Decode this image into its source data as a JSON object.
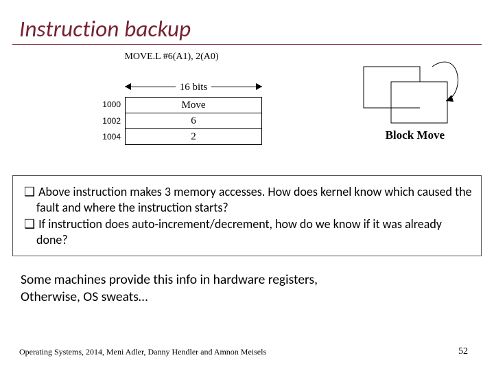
{
  "title": "Instruction backup",
  "asm": "MOVE.L #6(A1), 2(A0)",
  "bits_label": "16 bits",
  "addresses": {
    "r1": "1000",
    "r2": "1002",
    "r3": "1004"
  },
  "cells": {
    "r1": "Move",
    "r2": "6",
    "r3": "2"
  },
  "block_move": "Block Move",
  "bullets": {
    "b1": "Above instruction makes 3 memory accesses. How does kernel know which caused the fault and where the instruction starts?",
    "b2": "If instruction does auto-increment/decrement, how do we know if it was already done?"
  },
  "note": {
    "l1": "Some machines provide this info in hardware registers,",
    "l2": "Otherwise, OS sweats…"
  },
  "footer": "Operating Systems, 2014, Meni Adler, Danny Hendler and Amnon Meisels",
  "page": "52"
}
